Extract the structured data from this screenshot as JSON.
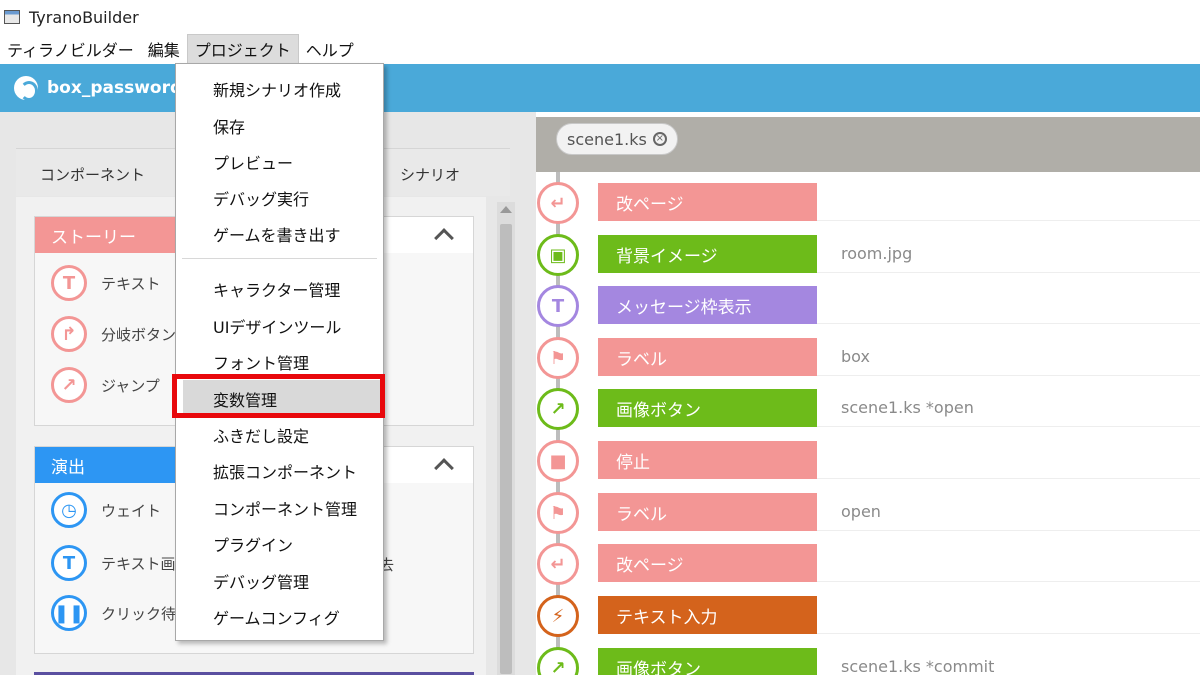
{
  "window": {
    "title": "TyranoBuilder"
  },
  "menubar": {
    "items": [
      "ティラノビルダー",
      "編集",
      "プロジェクト",
      "ヘルプ"
    ]
  },
  "project": {
    "name": "box_password_"
  },
  "left_tabs": {
    "components": "コンポーネント",
    "scenario": "シナリオ"
  },
  "sections": {
    "story": {
      "title": "ストーリー",
      "color": "#f39695",
      "items": [
        "テキスト",
        "分岐ボタン",
        "ジャンプ"
      ]
    },
    "effects": {
      "title": "演出",
      "color": "#2d96f3",
      "items": [
        "ウェイト",
        "テキスト画",
        "クリック待"
      ],
      "partial_right": "去"
    }
  },
  "dropdown": {
    "items": [
      "新規シナリオ作成",
      "保存",
      "プレビュー",
      "デバッグ実行",
      "ゲームを書き出す",
      "キャラクター管理",
      "UIデザインツール",
      "フォント管理",
      "変数管理",
      "ふきだし設定",
      "拡張コンポーネント",
      "コンポーネント管理",
      "プラグイン",
      "デバッグ管理",
      "ゲームコンフィグ"
    ],
    "highlighted": "変数管理"
  },
  "file_tab": {
    "name": "scene1.ks",
    "close": "×"
  },
  "rows": [
    {
      "label": "改ページ",
      "value": "",
      "color": "#f39695",
      "icon": "page-break-icon"
    },
    {
      "label": "背景イメージ",
      "value": "room.jpg",
      "color": "#6dbb1a",
      "icon": "background-image-icon"
    },
    {
      "label": "メッセージ枠表示",
      "value": "",
      "color": "#a487e0",
      "icon": "message-window-icon"
    },
    {
      "label": "ラベル",
      "value": "box",
      "color": "#f39695",
      "icon": "flag-icon"
    },
    {
      "label": "画像ボタン",
      "value": "scene1.ks *open",
      "color": "#6dbb1a",
      "icon": "image-button-icon"
    },
    {
      "label": "停止",
      "value": "",
      "color": "#f39695",
      "icon": "stop-icon"
    },
    {
      "label": "ラベル",
      "value": "open",
      "color": "#f39695",
      "icon": "flag-icon"
    },
    {
      "label": "改ページ",
      "value": "",
      "color": "#f39695",
      "icon": "page-break-icon"
    },
    {
      "label": "テキスト入力",
      "value": "",
      "color": "#d4631c",
      "icon": "lightning-icon"
    },
    {
      "label": "画像ボタン",
      "value": "scene1.ks *commit",
      "color": "#6dbb1a",
      "icon": "image-button-icon"
    }
  ]
}
